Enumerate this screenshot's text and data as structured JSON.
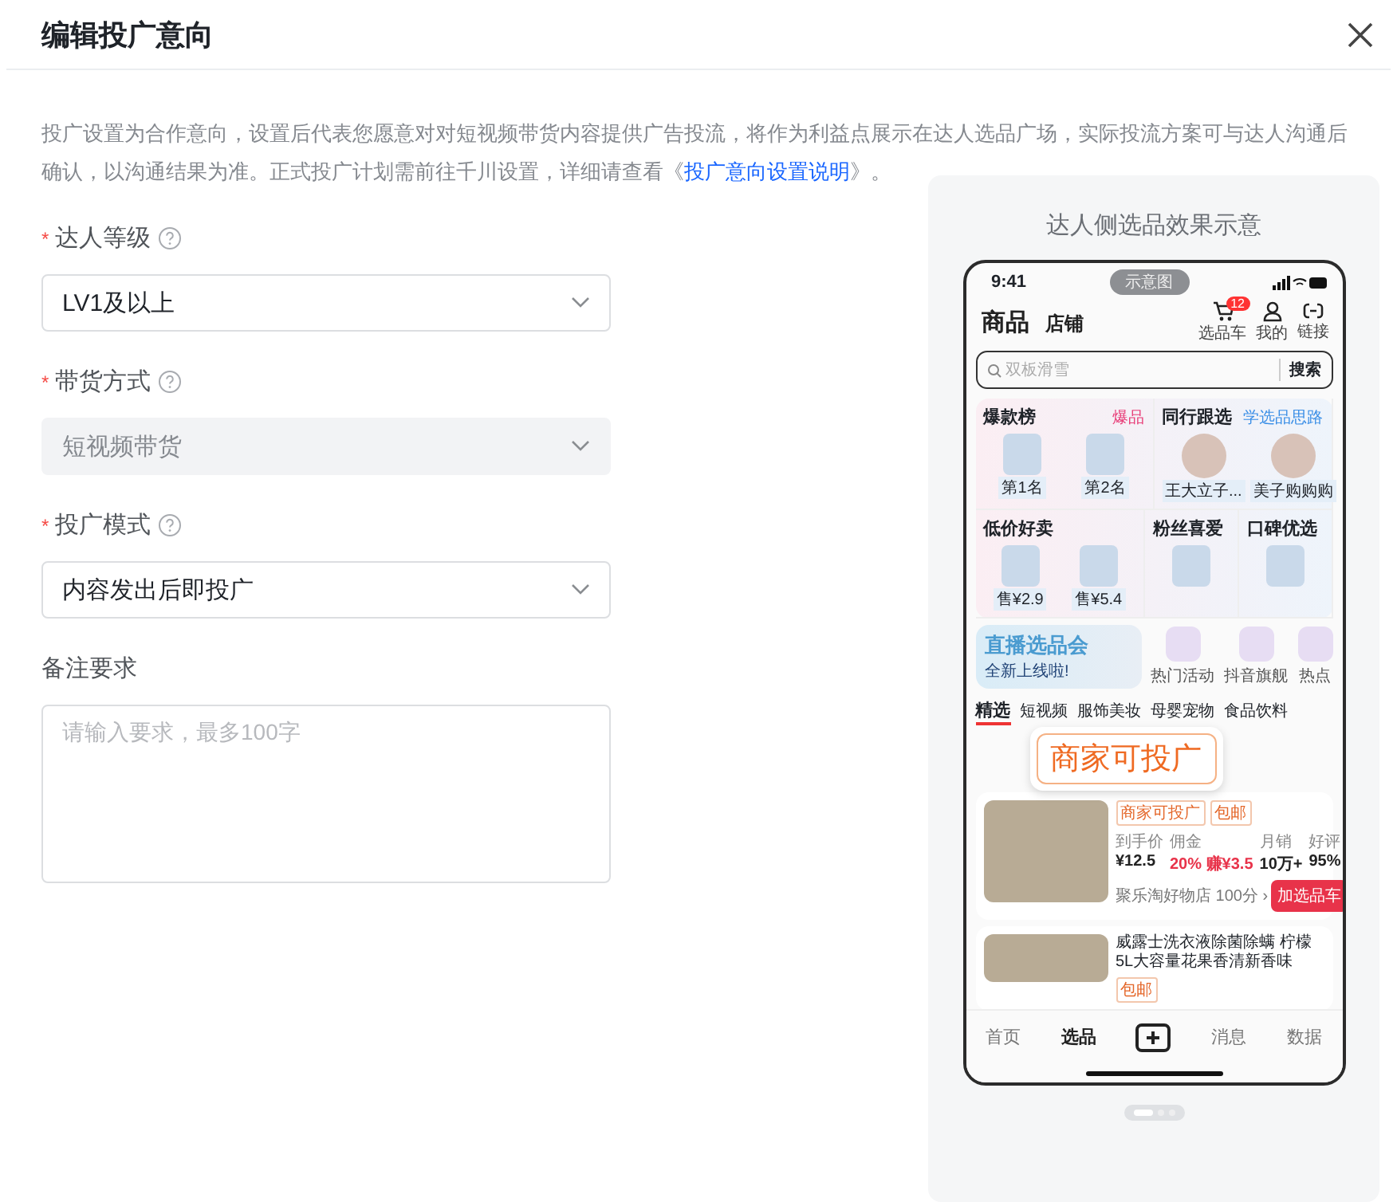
{
  "dialog": {
    "title": "编辑投广意向"
  },
  "description": {
    "text": "投广设置为合作意向，设置后代表您愿意对对短视频带货内容提供广告投流，将作为利益点展示在达人选品广场，实际投流方案可与达人沟通后确认，以沟通结果为准。正式投广计划需前往千川设置，详细请查看《",
    "link": "投广意向设置说明",
    "suffix": "》。"
  },
  "fields": [
    {
      "kind": "select",
      "required_mark": "*",
      "label": "达人等级",
      "help": true,
      "value": "LV1及以上",
      "disabled": false
    },
    {
      "kind": "select",
      "required_mark": "*",
      "label": "带货方式",
      "help": true,
      "value": "短视频带货",
      "disabled": true
    },
    {
      "kind": "select",
      "required_mark": "*",
      "label": "投广模式",
      "help": true,
      "value": "内容发出后即投广",
      "disabled": false
    },
    {
      "kind": "textarea",
      "label": "备注要求",
      "placeholder": "请输入要求，最多100字"
    }
  ],
  "preview": {
    "title": "达人侧选品效果示意",
    "phone": {
      "time": "9:41",
      "badge_label": "示意图",
      "tabs": [
        {
          "label": "商品",
          "selected": true
        },
        {
          "label": "店铺",
          "selected": false
        }
      ],
      "actions": [
        {
          "kind": "cart",
          "label": "选品车",
          "count": "12"
        },
        {
          "kind": "user",
          "label": "我的"
        },
        {
          "kind": "link",
          "label": "链接"
        }
      ],
      "search": {
        "placeholder": "双板滑雪",
        "button": "搜索"
      },
      "section_rows": [
        [
          {
            "title": "爆款榜",
            "tag": "爆品",
            "color": "#e8407a",
            "items": [
              {
                "kind": "product",
                "caption": "第1名"
              },
              {
                "kind": "product",
                "caption": "第2名"
              }
            ]
          },
          {
            "title": "同行跟选",
            "tag": "学选品思路",
            "color": "#3a8ee6",
            "items": [
              {
                "kind": "avatar",
                "caption": "王大立子..."
              },
              {
                "kind": "avatar",
                "caption": "美子购购购"
              }
            ]
          }
        ],
        [
          {
            "title": "低价好卖",
            "items": [
              {
                "kind": "product",
                "caption": "售¥2.9"
              },
              {
                "kind": "product",
                "caption": "售¥5.4"
              }
            ]
          },
          {
            "title": "粉丝喜爱",
            "items": [
              {
                "kind": "product"
              }
            ]
          },
          {
            "title": "口碑优选",
            "items": [
              {
                "kind": "product"
              }
            ]
          }
        ]
      ],
      "banner": {
        "title": "直播选品会",
        "subtitle": "全新上线啦!"
      },
      "shortcuts": [
        "热门活动",
        "抖音旗舰",
        "热点"
      ],
      "category_tabs": [
        {
          "label": "精选",
          "selected": true
        },
        {
          "label": "短视频",
          "selected": false
        },
        {
          "label": "服饰美妆",
          "selected": false
        },
        {
          "label": "母婴宠物",
          "selected": false
        },
        {
          "label": "食品饮料",
          "selected": false
        }
      ],
      "overlay_label": "商家可投广",
      "products": [
        {
          "tags": [
            "商家可投广",
            "包邮"
          ],
          "stats": [
            {
              "label": "到手价",
              "value": "¥12.5",
              "highlight": false
            },
            {
              "label": "佣金",
              "value": "20% 赚¥3.5",
              "highlight": true
            },
            {
              "label": "月销",
              "value": "10万+",
              "highlight": false
            },
            {
              "label": "好评",
              "value": "95%",
              "highlight": false
            }
          ],
          "shop": "聚乐淘好物店 100分 ›",
          "button": "加选品车"
        },
        {
          "title": "威露士洗衣液除菌除螨 柠檬5L大容量花果香清新香味",
          "tags": [
            "包邮"
          ]
        }
      ],
      "nav": [
        {
          "kind": "tab",
          "label": "首页",
          "selected": false
        },
        {
          "kind": "tab",
          "label": "选品",
          "selected": true
        },
        {
          "kind": "add",
          "selected": false
        },
        {
          "kind": "tab",
          "label": "消息",
          "selected": false
        },
        {
          "kind": "tab",
          "label": "数据",
          "selected": false
        }
      ]
    },
    "pager": [
      {
        "selected": true
      },
      {
        "selected": false
      },
      {
        "selected": false
      }
    ]
  }
}
